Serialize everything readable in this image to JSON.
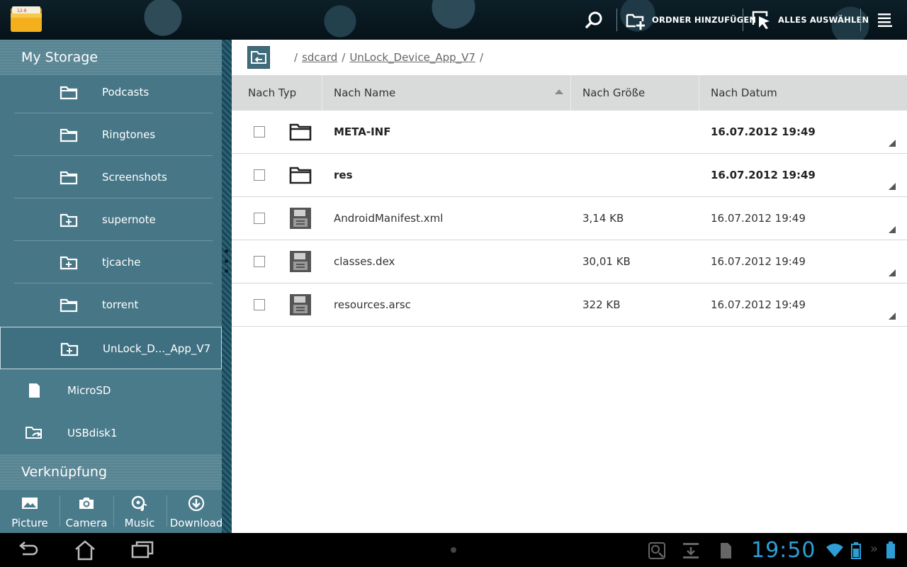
{
  "actionbar": {
    "app_icon": "file-manager-folder-icon",
    "search_icon": "search-icon",
    "add_folder_label": "ORDNER HINZUFÜGEN",
    "select_all_label": "ALLES AUSWÄHLEN",
    "menu_icon": "overflow-menu-icon"
  },
  "sidebar": {
    "storage_header": "My Storage",
    "folders": [
      {
        "label": "Podcasts",
        "icon": "folder-icon"
      },
      {
        "label": "Ringtones",
        "icon": "folder-icon"
      },
      {
        "label": "Screenshots",
        "icon": "folder-icon"
      },
      {
        "label": "supernote",
        "icon": "folder-plus-icon"
      },
      {
        "label": "tjcache",
        "icon": "folder-plus-icon"
      },
      {
        "label": "torrent",
        "icon": "folder-icon"
      },
      {
        "label": "UnLock_D..._App_V7",
        "icon": "folder-plus-icon",
        "selected": true
      }
    ],
    "devices": [
      {
        "label": "MicroSD",
        "icon": "sd-card-icon"
      },
      {
        "label": "USBdisk1",
        "icon": "usb-disk-icon"
      }
    ],
    "shortcuts_header": "Verknüpfung",
    "shortcuts": [
      {
        "label": "Picture",
        "icon": "picture-icon"
      },
      {
        "label": "Camera",
        "icon": "camera-icon"
      },
      {
        "label": "Music",
        "icon": "music-icon"
      },
      {
        "label": "Download",
        "icon": "download-icon"
      }
    ]
  },
  "path": {
    "back_icon": "parent-folder-back-icon",
    "separator": "/",
    "segments": [
      "sdcard",
      "UnLock_Device_App_V7"
    ]
  },
  "columns": {
    "type": "Nach Typ",
    "name": "Nach Name",
    "size": "Nach Größe",
    "date": "Nach Datum",
    "sort_column": "name",
    "sort_direction": "ascending"
  },
  "files": [
    {
      "name": "META-INF",
      "size": "",
      "date": "16.07.2012 19:49",
      "kind": "folder"
    },
    {
      "name": "res",
      "size": "",
      "date": "16.07.2012 19:49",
      "kind": "folder"
    },
    {
      "name": "AndroidManifest.xml",
      "size": "3,14 KB",
      "date": "16.07.2012 19:49",
      "kind": "file"
    },
    {
      "name": "classes.dex",
      "size": "30,01 KB",
      "date": "16.07.2012 19:49",
      "kind": "file"
    },
    {
      "name": "resources.arsc",
      "size": "322 KB",
      "date": "16.07.2012 19:49",
      "kind": "file"
    }
  ],
  "system": {
    "clock": "19:50",
    "nav": [
      "back-icon",
      "home-icon",
      "recent-apps-icon"
    ],
    "status_icons": [
      "usb-debug-icon",
      "download-notification-icon",
      "sd-card-notification-icon",
      "wifi-icon",
      "battery-icon"
    ]
  },
  "colors": {
    "sidebar": "#477787",
    "sidebar_header": "#5b8796",
    "accent_clock": "#2e9fd6",
    "column_header": "#d9dbdb"
  }
}
